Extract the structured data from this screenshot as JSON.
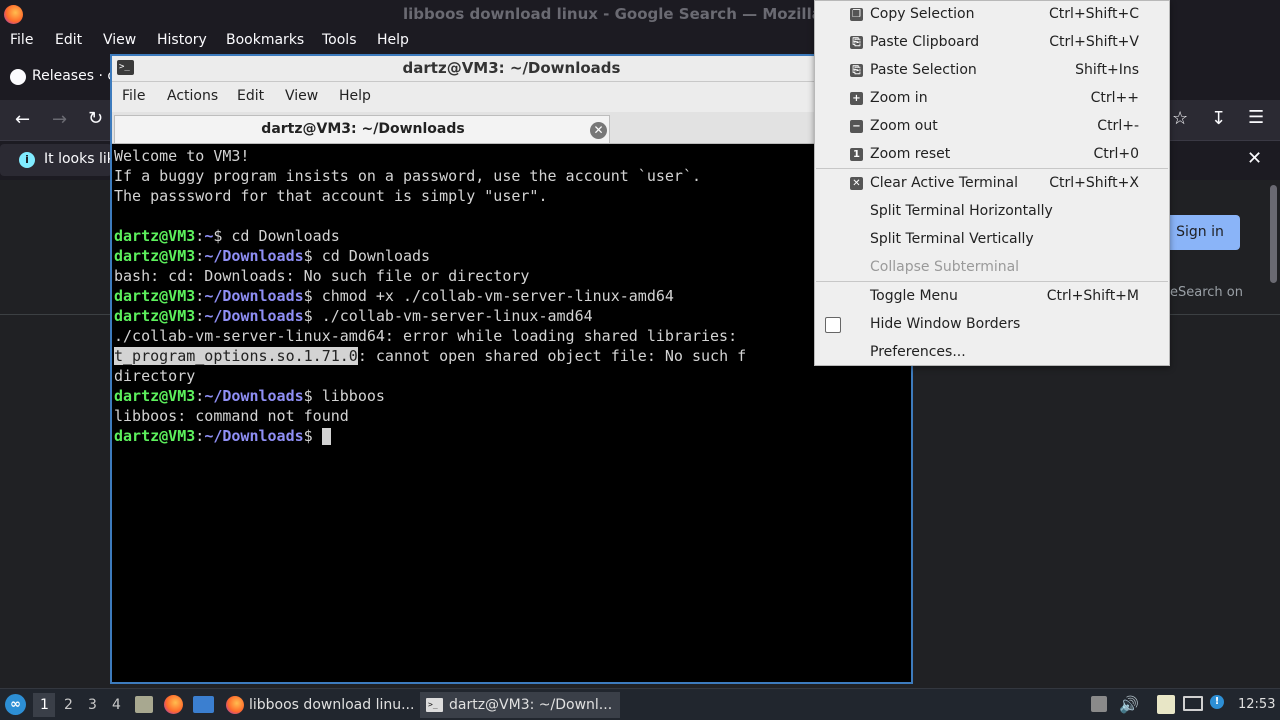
{
  "firefox": {
    "window_title": "libboos download linux - Google Search — Mozilla Firefox",
    "menu": [
      "File",
      "Edit",
      "View",
      "History",
      "Bookmarks",
      "Tools",
      "Help"
    ],
    "tab_label": "Releases · c",
    "info_text": "It looks lik",
    "sign_in": "Sign in",
    "safesearch_text": "eSearch on"
  },
  "terminal": {
    "window_title": "dartz@VM3: ~/Downloads",
    "menu": [
      "File",
      "Actions",
      "Edit",
      "View",
      "Help"
    ],
    "tab_title": "dartz@VM3: ~/Downloads",
    "lines": [
      {
        "text": "Welcome to VM3!"
      },
      {
        "text": "If a buggy program insists on a password, use the account `user`."
      },
      {
        "text": "The passsword for that account is simply \"user\"."
      },
      {
        "text": ""
      },
      {
        "user": "dartz@VM3",
        "path": "~",
        "cmd": " cd Downloads"
      },
      {
        "user": "dartz@VM3",
        "path": "~/Downloads",
        "cmd": " cd Downloads"
      },
      {
        "text": "bash: cd: Downloads: No such file or directory"
      },
      {
        "user": "dartz@VM3",
        "path": "~/Downloads",
        "cmd": " chmod +x ./collab-vm-server-linux-amd64"
      },
      {
        "user": "dartz@VM3",
        "path": "~/Downloads",
        "cmd": " ./collab-vm-server-linux-amd64"
      },
      {
        "text": "./collab-vm-server-linux-amd64: error while loading shared libraries: "
      },
      {
        "highlight": "t_program_options.so.1.71.0",
        "text": ": cannot open shared object file: No such f"
      },
      {
        "text": "directory"
      },
      {
        "user": "dartz@VM3",
        "path": "~/Downloads",
        "cmd": " libboos"
      },
      {
        "text": "libboos: command not found"
      },
      {
        "user": "dartz@VM3",
        "path": "~/Downloads",
        "cmd": " ",
        "cursor": true
      }
    ]
  },
  "context_menu": {
    "items": [
      {
        "label": "Copy Selection",
        "shortcut": "Ctrl+Shift+C",
        "icon": "copy-icon"
      },
      {
        "label": "Paste Clipboard",
        "shortcut": "Ctrl+Shift+V",
        "icon": "paste-icon"
      },
      {
        "label": "Paste Selection",
        "shortcut": "Shift+Ins",
        "icon": "paste-icon"
      },
      {
        "label": "Zoom in",
        "shortcut": "Ctrl++",
        "icon": "zoom-in-icon"
      },
      {
        "label": "Zoom out",
        "shortcut": "Ctrl+-",
        "icon": "zoom-out-icon"
      },
      {
        "label": "Zoom reset",
        "shortcut": "Ctrl+0",
        "icon": "zoom-reset-icon"
      },
      {
        "label": "Clear Active Terminal",
        "shortcut": "Ctrl+Shift+X",
        "icon": "clear-icon"
      },
      {
        "label": "Split Terminal Horizontally",
        "shortcut": ""
      },
      {
        "label": "Split Terminal Vertically",
        "shortcut": ""
      },
      {
        "label": "Collapse Subterminal",
        "shortcut": "",
        "disabled": true
      },
      {
        "label": "Toggle Menu",
        "shortcut": "Ctrl+Shift+M"
      },
      {
        "label": "Hide Window Borders",
        "shortcut": "",
        "checkbox": false
      },
      {
        "label": "Preferences...",
        "shortcut": ""
      }
    ]
  },
  "taskbar": {
    "workspaces": [
      "1",
      "2",
      "3",
      "4"
    ],
    "tasks": [
      {
        "label": "libboos download linu...",
        "icon": "firefox-icon"
      },
      {
        "label": "dartz@VM3: ~/Downl...",
        "icon": "terminal-icon"
      }
    ],
    "clock": "12:53"
  }
}
